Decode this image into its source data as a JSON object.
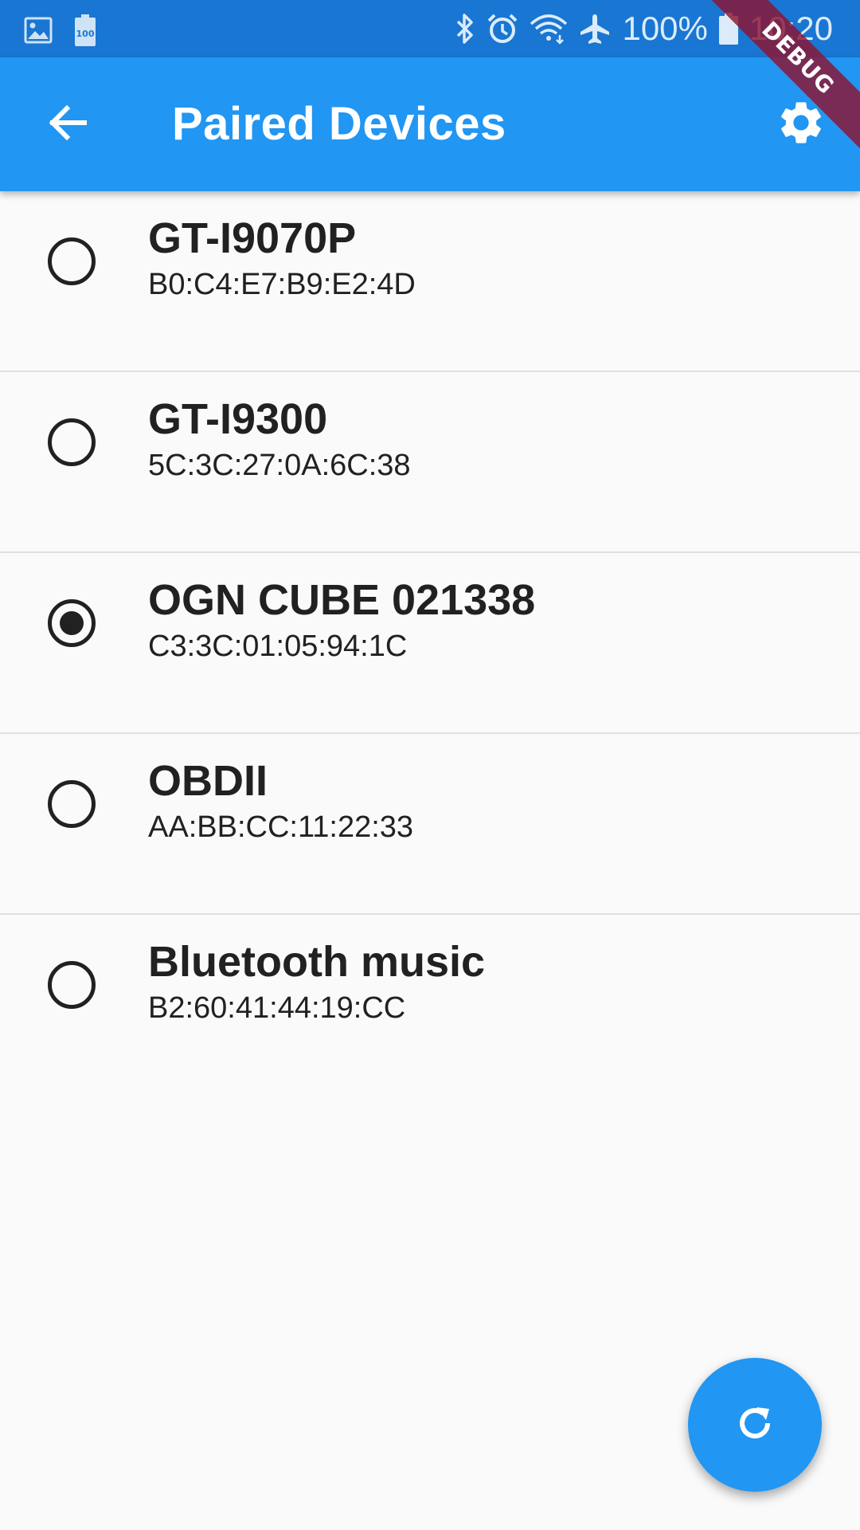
{
  "status_bar": {
    "battery_percent": "100%",
    "time": "10:20",
    "left_icons": [
      "gallery-icon",
      "battery-saver-icon"
    ],
    "right_icons": [
      "bluetooth-icon",
      "alarm-icon",
      "wifi-icon",
      "airplane-icon",
      "battery-icon"
    ]
  },
  "app_bar": {
    "title": "Paired Devices",
    "back_icon": "arrow-back-icon",
    "settings_icon": "gear-icon",
    "color": "#2196F3"
  },
  "debug_banner": {
    "label": "DEBUG"
  },
  "devices": [
    {
      "name": "GT-I9070P",
      "address": "B0:C4:E7:B9:E2:4D",
      "selected": false
    },
    {
      "name": "GT-I9300",
      "address": "5C:3C:27:0A:6C:38",
      "selected": false
    },
    {
      "name": "OGN CUBE 021338",
      "address": "C3:3C:01:05:94:1C",
      "selected": true
    },
    {
      "name": "OBDII",
      "address": "AA:BB:CC:11:22:33",
      "selected": false
    },
    {
      "name": "Bluetooth music",
      "address": "B2:60:41:44:19:CC",
      "selected": false
    }
  ],
  "fab": {
    "icon": "refresh-icon",
    "color": "#2196F3"
  }
}
